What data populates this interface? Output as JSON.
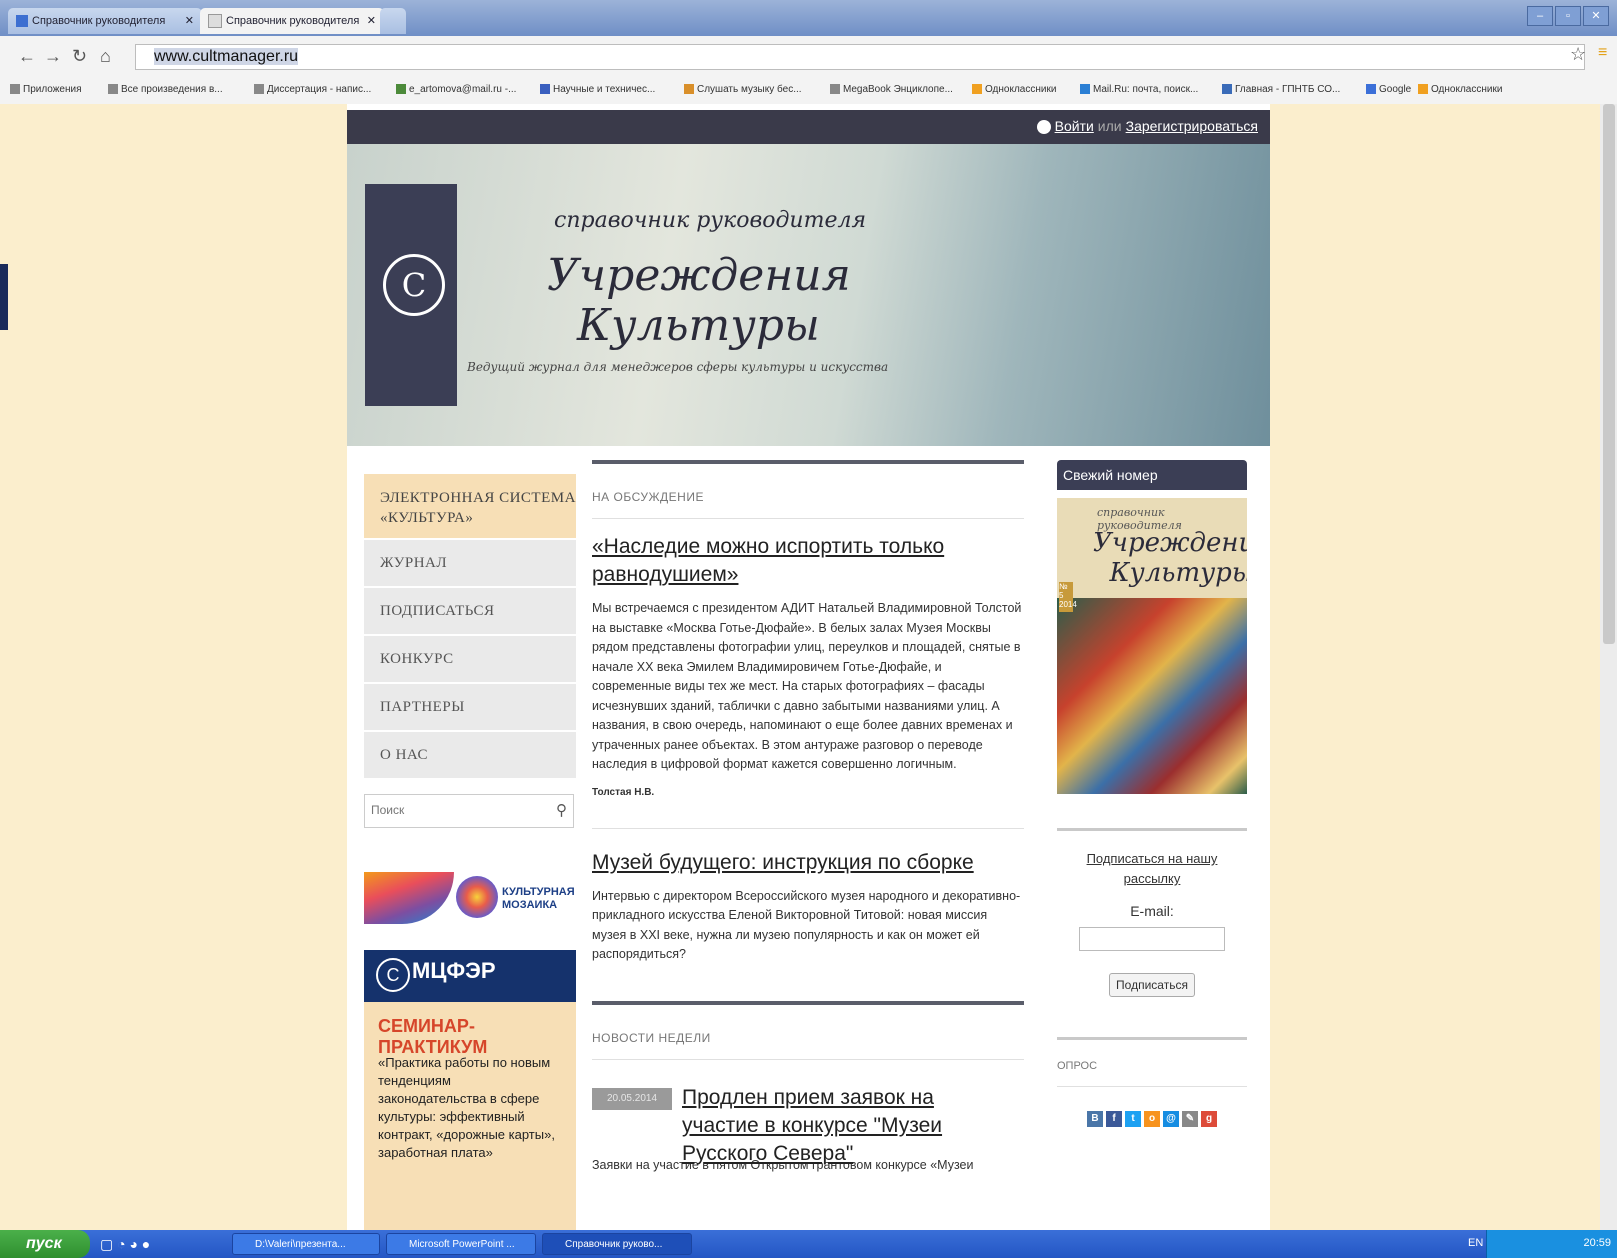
{
  "browser": {
    "tabs": [
      {
        "label": "Справочник руководителя",
        "active": false
      },
      {
        "label": "Справочник руководителя",
        "active": true
      }
    ],
    "url_host": "www.cultmanager.ru",
    "bookmarks": [
      "Приложения",
      "Все произведения в...",
      "Диссертация - напис...",
      "e_artomova@mail.ru -...",
      "Научные и техничес...",
      "Слушать музыку бес...",
      "MegaBook Энциклопе...",
      "Одноклассники",
      "Mail.Ru: почта, поиск...",
      "Главная - ГПНТБ СО...",
      "Google",
      "Одноклассники"
    ]
  },
  "site": {
    "login": "Войти",
    "or": "или",
    "register": "Зарегистрироваться",
    "banner": {
      "line1": "справочник руководителя",
      "line2": "Учреждения",
      "line3": "Культуры",
      "tagline": "Ведущий журнал для менеджеров сферы культуры и искусства",
      "logo_char": "С"
    },
    "nav": [
      "ЭЛЕКТРОННАЯ СИСТЕМА «КУЛЬТУРА»",
      "ЖУРНАЛ",
      "ПОДПИСАТЬСЯ",
      "КОНКУРС",
      "ПАРТНЕРЫ",
      "О НАС"
    ],
    "search_placeholder": "Поиск",
    "mozaika": "КУЛЬТУРНАЯ МОЗАИКА",
    "mcfer": {
      "name": "МЦФЭР",
      "seminar": "СЕМИНАР-ПРАКТИКУМ",
      "desc": "«Практика работы по новым тенденциям законодательства в сфере культуры: эффективный контракт, «дорожные карты», заработная плата»"
    },
    "discussion": {
      "header": "НА ОБСУЖДЕНИЕ",
      "article1": {
        "title": "«Наследие можно испортить только равнодушием»",
        "text": "Мы встречаемся с президентом АДИТ Натальей Владимировной Толстой на выставке «Москва Готье-Дюфайе». В белых залах Музея Москвы рядом представлены фотографии улиц, переулков и площадей, снятые в начале XX века Эмилем Владимировичем Готье-Дюфайе, и современные виды тех же мест. На старых фотографиях – фасады исчезнувших зданий, таблички с давно забытыми названиями улиц. А названия, в свою очередь, напоминают о еще более давних временах и утраченных ранее объектах. В этом антураже разговор о переводе наследия в цифровой формат кажется совершенно логичным.",
        "author": "Толстая Н.В."
      },
      "article2": {
        "title": "Музей будущего: инструкция по сборке",
        "text": "Интервью с директором Всероссийского музея народного и декоративно-прикладного искусства Еленой Викторовной Титовой: новая миссия музея в XXI веке, нужна ли музею популярность и как он может ей распорядиться?"
      }
    },
    "news": {
      "header": "НОВОСТИ НЕДЕЛИ",
      "date": "20.05.2014",
      "title": "Продлен прием заявок на участие в конкурсе \"Музеи Русского Севера\"",
      "text": "Заявки на участие в пятом Открытом грантовом конкурсе «Музеи"
    },
    "right": {
      "issue_header": "Свежий номер",
      "cover_line1": "справочник руководителя",
      "cover_line2": "Учреждения",
      "cover_line3": "Культуры",
      "cover_num": "№ 5 2014",
      "subscribe_link": "Подписаться на нашу рассылку",
      "email_label": "E-mail:",
      "subscribe_button": "Подписаться",
      "poll": "ОПРОС"
    },
    "share_colors": [
      "#4a76a8",
      "#3b5998",
      "#1da1f2",
      "#f7931e",
      "#168de2",
      "#888888",
      "#dd4b39"
    ]
  },
  "taskbar": {
    "start": "пуск",
    "tasks": [
      "D:\\Valeri\\презента...",
      "Microsoft PowerPoint ...",
      "Справочник руково..."
    ],
    "lang": "EN",
    "clock": "20:59"
  }
}
